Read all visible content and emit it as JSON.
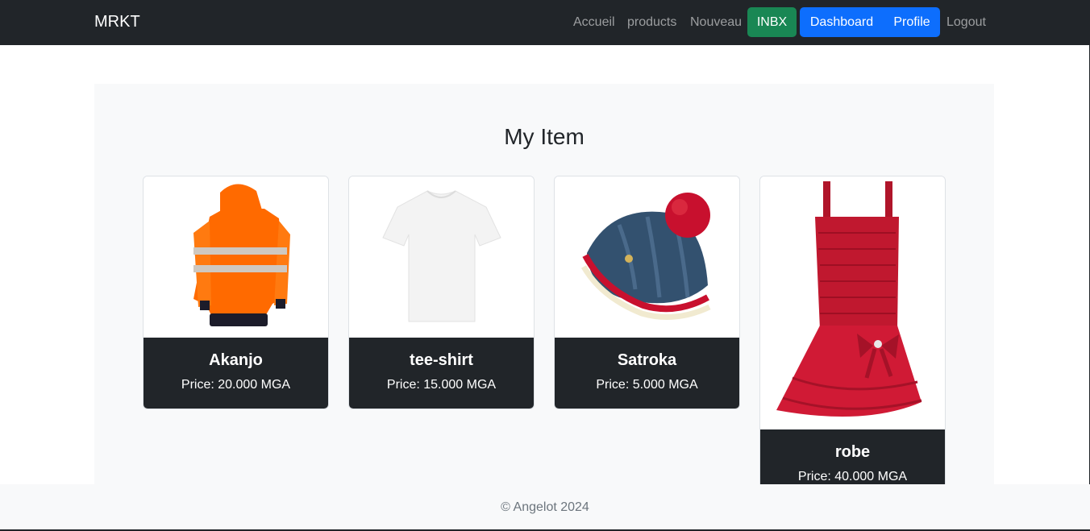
{
  "navbar": {
    "brand": "MRKT",
    "links": [
      "Accueil",
      "products",
      "Nouveau"
    ],
    "inbox_label": "INBX",
    "dashboard_label": "Dashboard",
    "profile_label": "Profile",
    "logout_label": "Logout"
  },
  "main": {
    "title": "My Item",
    "items": [
      {
        "name": "Akanjo",
        "price": "Price: 20.000 MGA",
        "image": "orange-jacket"
      },
      {
        "name": "tee-shirt",
        "price": "Price: 15.000 MGA",
        "image": "white-tshirt"
      },
      {
        "name": "Satroka",
        "price": "Price: 5.000 MGA",
        "image": "knit-beanie"
      },
      {
        "name": "robe",
        "price": "Price: 40.000 MGA",
        "image": "red-dress"
      }
    ]
  },
  "footer": {
    "text": "© Angelot 2024"
  },
  "colors": {
    "navbar_bg": "#212529",
    "inbox_btn": "#198754",
    "primary_btn": "#0d6efd",
    "card_body_bg": "#212529",
    "page_panel_bg": "#f8f9fa"
  }
}
